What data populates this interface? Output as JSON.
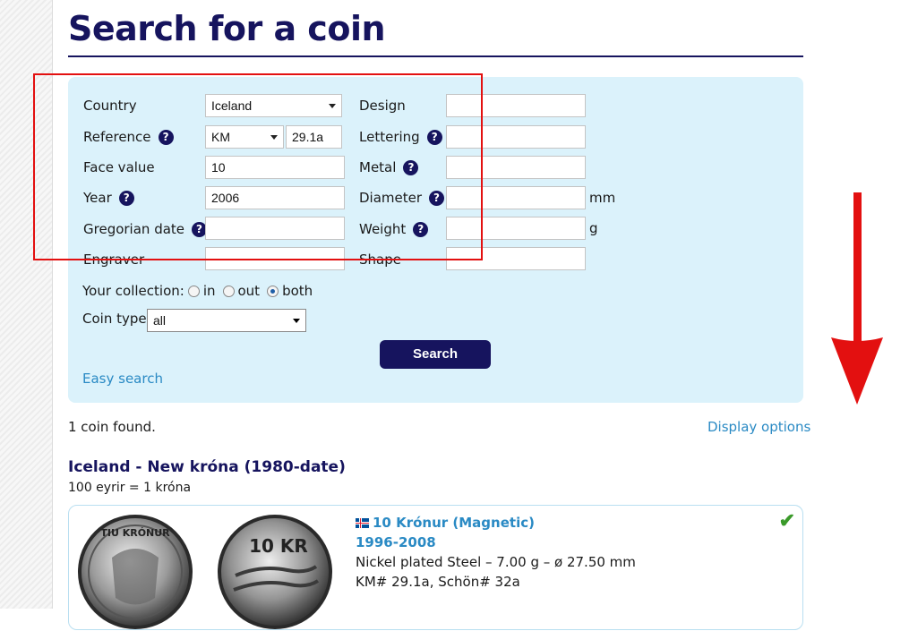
{
  "page": {
    "title": "Search for a coin"
  },
  "form": {
    "country_label": "Country",
    "country_value": "Iceland",
    "reference_label": "Reference",
    "reference_catalog": "KM",
    "reference_number": "29.1a",
    "face_value_label": "Face value",
    "face_value": "10",
    "year_label": "Year",
    "year_value": "2006",
    "gregorian_label": "Gregorian date",
    "gregorian_value": "",
    "engraver_label": "Engraver",
    "engraver_value": "",
    "design_label": "Design",
    "lettering_label": "Lettering",
    "metal_label": "Metal",
    "diameter_label": "Diameter",
    "diameter_unit": "mm",
    "weight_label": "Weight",
    "weight_unit": "g",
    "shape_label": "Shape",
    "help_glyph": "?",
    "collection_label": "Your collection:",
    "collection_options": [
      "in",
      "out",
      "both"
    ],
    "collection_selected": "both",
    "coin_type_label": "Coin type:",
    "coin_type_value": "all",
    "search_button": "Search",
    "easy_search_link": "Easy search"
  },
  "results": {
    "count_text": "1 coin found.",
    "display_options": "Display options",
    "group_title": "Iceland - New króna (1980-date)",
    "group_subtitle": "100 eyrir = 1 króna",
    "items": [
      {
        "name": "10 Krónur (Magnetic)",
        "years": "1996-2008",
        "specs": "Nickel plated Steel – 7.00 g – ø 27.50 mm",
        "refs": "KM# 29.1a, Schön# 32a",
        "obverse_text": "TIU KRÓNUR",
        "reverse_text": "10 KR"
      }
    ]
  },
  "annotation": {
    "box_color": "#e31010",
    "arrow_color": "#e31010"
  },
  "colors": {
    "brand_navy": "#16145e",
    "panel_bg": "#dbf2fb",
    "link_blue": "#2a8ac4",
    "owned_check": "#3a9a2a"
  }
}
